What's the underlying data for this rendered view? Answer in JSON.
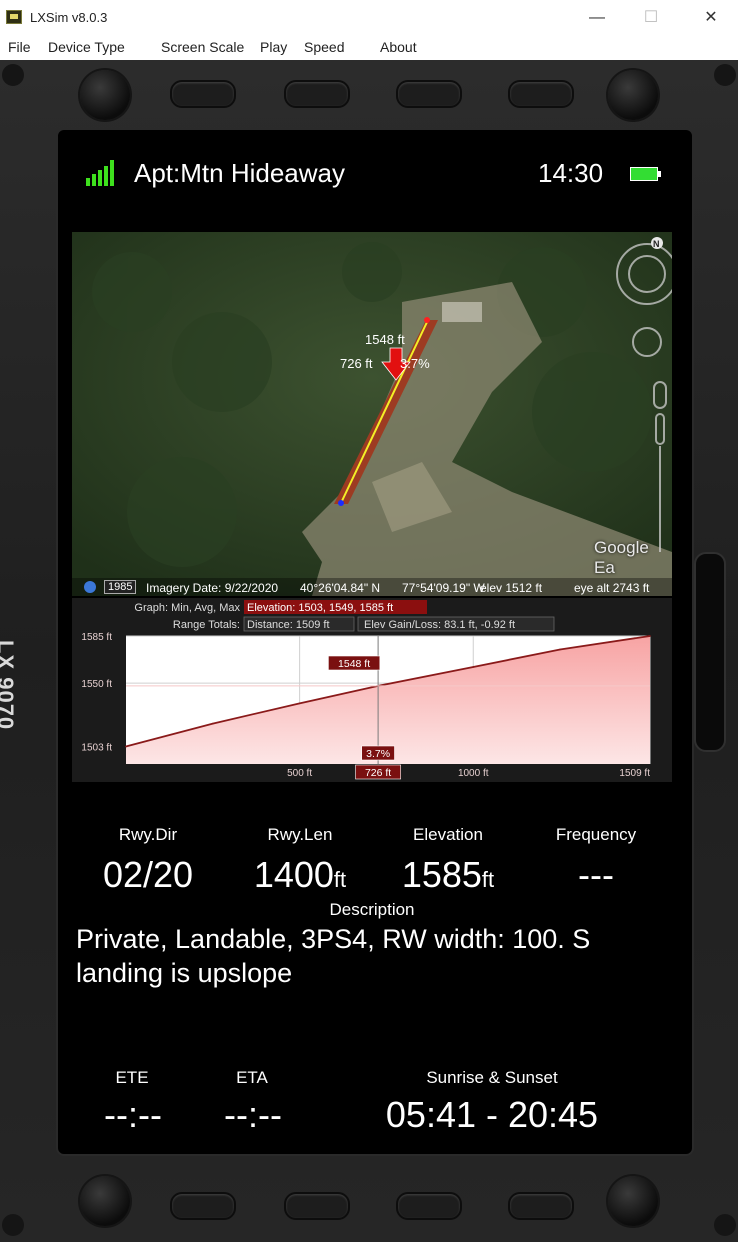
{
  "window": {
    "title": "LXSim v8.0.3",
    "minimize_glyph": "—",
    "maximize_glyph": "☐",
    "close_glyph": "✕"
  },
  "menu": {
    "items": [
      "File",
      "Device Type",
      "Screen Scale",
      "Play",
      "Speed",
      "About"
    ]
  },
  "device": {
    "model": "LX 9070"
  },
  "status": {
    "airport": "Apt:Mtn Hideaway",
    "time": "14:30",
    "signal_icon": "signal-bars-icon",
    "battery_icon": "battery-icon",
    "signal_color": "#3ee01d",
    "battery_color": "#33dd33"
  },
  "map": {
    "runway_top_label": "1548 ft",
    "runway_left_label": "726 ft",
    "runway_slope_label": "3.7%",
    "compass_label": "N",
    "attribution": "Google Ea",
    "footer": {
      "tour_badge": "1985",
      "imagery_date": "Imagery Date: 9/22/2020",
      "lat": "40°26'04.84\" N",
      "lon": "77°54'09.19\" W",
      "elev": "elev  1512 ft",
      "eye_alt": "eye alt   2743 ft"
    }
  },
  "graph": {
    "header1_label": "Graph: Min, Avg, Max",
    "header1_value": "Elevation: 1503, 1549, 1585 ft",
    "header2_label": "Range Totals:",
    "header2_distance": "Distance: 1509 ft",
    "header2_gain": "Elev Gain/Loss: 83.1 ft, -0.92 ft",
    "y_ticks": [
      "1585 ft",
      "1550 ft",
      "1503 ft"
    ],
    "x_ticks": [
      "500 ft",
      "1000 ft",
      "1509 ft"
    ],
    "cursor_elev_label": "1548 ft",
    "cursor_slope_label": "3.7%",
    "cursor_dist_label": "726 ft"
  },
  "chart_data": {
    "type": "area",
    "xlabel": "",
    "ylabel": "",
    "x": [
      0,
      250,
      500,
      726,
      1000,
      1250,
      1509
    ],
    "y": [
      1503,
      1520,
      1535,
      1548,
      1562,
      1575,
      1585
    ],
    "xlim": [
      0,
      1509
    ],
    "ylim": [
      1490,
      1585
    ],
    "y_tick_values": [
      1585,
      1550,
      1503
    ],
    "x_tick_values": [
      500,
      1000,
      1509
    ],
    "cursor_x": 726,
    "series": [
      {
        "name": "",
        "color": "#8a1a1a"
      }
    ]
  },
  "info": {
    "rwy_dir_label": "Rwy.Dir",
    "rwy_dir_value": "02/20",
    "rwy_len_label": "Rwy.Len",
    "rwy_len_value": "1400",
    "rwy_len_unit": "ft",
    "elevation_label": "Elevation",
    "elevation_value": "1585",
    "elevation_unit": "ft",
    "frequency_label": "Frequency",
    "frequency_value": "---",
    "description_label": "Description",
    "description_line1": "Private, Landable, 3PS4, RW width: 100. S",
    "description_line2": "landing is upslope",
    "ete_label": "ETE",
    "ete_value": "--:--",
    "eta_label": "ETA",
    "eta_value": "--:--",
    "sun_label": "Sunrise & Sunset",
    "sun_value": "05:41 - 20:45"
  }
}
